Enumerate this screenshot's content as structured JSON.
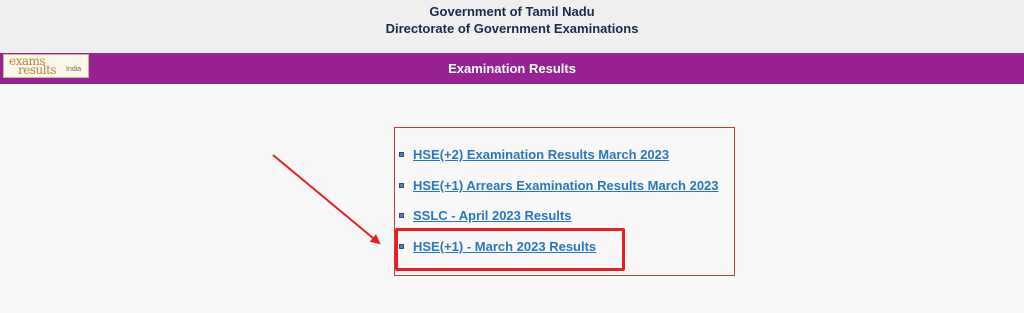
{
  "header": {
    "line1": "Government of Tamil Nadu",
    "line2": "Directorate of Government Examinations"
  },
  "bar": {
    "title": "Examination Results",
    "color": "#972293"
  },
  "logo": {
    "word1": "exams",
    "word2": "results",
    "word3": "India"
  },
  "results": {
    "items": [
      {
        "label": "HSE(+2) Examination Results March 2023"
      },
      {
        "label": "HSE(+1) Arrears Examination Results March 2023"
      },
      {
        "label": "SSLC - April 2023 Results"
      },
      {
        "label": "HSE(+1) - March 2023 Results"
      }
    ],
    "link_color": "#2b76c0",
    "highlight_color": "#ec1c24"
  }
}
